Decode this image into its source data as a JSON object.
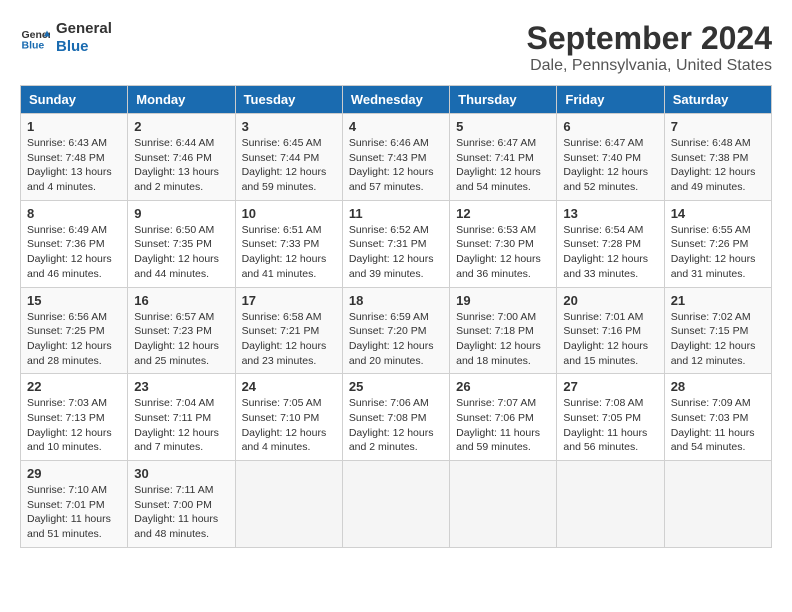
{
  "logo": {
    "line1": "General",
    "line2": "Blue"
  },
  "title": "September 2024",
  "subtitle": "Dale, Pennsylvania, United States",
  "weekdays": [
    "Sunday",
    "Monday",
    "Tuesday",
    "Wednesday",
    "Thursday",
    "Friday",
    "Saturday"
  ],
  "weeks": [
    [
      {
        "day": "1",
        "info": "Sunrise: 6:43 AM\nSunset: 7:48 PM\nDaylight: 13 hours\nand 4 minutes."
      },
      {
        "day": "2",
        "info": "Sunrise: 6:44 AM\nSunset: 7:46 PM\nDaylight: 13 hours\nand 2 minutes."
      },
      {
        "day": "3",
        "info": "Sunrise: 6:45 AM\nSunset: 7:44 PM\nDaylight: 12 hours\nand 59 minutes."
      },
      {
        "day": "4",
        "info": "Sunrise: 6:46 AM\nSunset: 7:43 PM\nDaylight: 12 hours\nand 57 minutes."
      },
      {
        "day": "5",
        "info": "Sunrise: 6:47 AM\nSunset: 7:41 PM\nDaylight: 12 hours\nand 54 minutes."
      },
      {
        "day": "6",
        "info": "Sunrise: 6:47 AM\nSunset: 7:40 PM\nDaylight: 12 hours\nand 52 minutes."
      },
      {
        "day": "7",
        "info": "Sunrise: 6:48 AM\nSunset: 7:38 PM\nDaylight: 12 hours\nand 49 minutes."
      }
    ],
    [
      {
        "day": "8",
        "info": "Sunrise: 6:49 AM\nSunset: 7:36 PM\nDaylight: 12 hours\nand 46 minutes."
      },
      {
        "day": "9",
        "info": "Sunrise: 6:50 AM\nSunset: 7:35 PM\nDaylight: 12 hours\nand 44 minutes."
      },
      {
        "day": "10",
        "info": "Sunrise: 6:51 AM\nSunset: 7:33 PM\nDaylight: 12 hours\nand 41 minutes."
      },
      {
        "day": "11",
        "info": "Sunrise: 6:52 AM\nSunset: 7:31 PM\nDaylight: 12 hours\nand 39 minutes."
      },
      {
        "day": "12",
        "info": "Sunrise: 6:53 AM\nSunset: 7:30 PM\nDaylight: 12 hours\nand 36 minutes."
      },
      {
        "day": "13",
        "info": "Sunrise: 6:54 AM\nSunset: 7:28 PM\nDaylight: 12 hours\nand 33 minutes."
      },
      {
        "day": "14",
        "info": "Sunrise: 6:55 AM\nSunset: 7:26 PM\nDaylight: 12 hours\nand 31 minutes."
      }
    ],
    [
      {
        "day": "15",
        "info": "Sunrise: 6:56 AM\nSunset: 7:25 PM\nDaylight: 12 hours\nand 28 minutes."
      },
      {
        "day": "16",
        "info": "Sunrise: 6:57 AM\nSunset: 7:23 PM\nDaylight: 12 hours\nand 25 minutes."
      },
      {
        "day": "17",
        "info": "Sunrise: 6:58 AM\nSunset: 7:21 PM\nDaylight: 12 hours\nand 23 minutes."
      },
      {
        "day": "18",
        "info": "Sunrise: 6:59 AM\nSunset: 7:20 PM\nDaylight: 12 hours\nand 20 minutes."
      },
      {
        "day": "19",
        "info": "Sunrise: 7:00 AM\nSunset: 7:18 PM\nDaylight: 12 hours\nand 18 minutes."
      },
      {
        "day": "20",
        "info": "Sunrise: 7:01 AM\nSunset: 7:16 PM\nDaylight: 12 hours\nand 15 minutes."
      },
      {
        "day": "21",
        "info": "Sunrise: 7:02 AM\nSunset: 7:15 PM\nDaylight: 12 hours\nand 12 minutes."
      }
    ],
    [
      {
        "day": "22",
        "info": "Sunrise: 7:03 AM\nSunset: 7:13 PM\nDaylight: 12 hours\nand 10 minutes."
      },
      {
        "day": "23",
        "info": "Sunrise: 7:04 AM\nSunset: 7:11 PM\nDaylight: 12 hours\nand 7 minutes."
      },
      {
        "day": "24",
        "info": "Sunrise: 7:05 AM\nSunset: 7:10 PM\nDaylight: 12 hours\nand 4 minutes."
      },
      {
        "day": "25",
        "info": "Sunrise: 7:06 AM\nSunset: 7:08 PM\nDaylight: 12 hours\nand 2 minutes."
      },
      {
        "day": "26",
        "info": "Sunrise: 7:07 AM\nSunset: 7:06 PM\nDaylight: 11 hours\nand 59 minutes."
      },
      {
        "day": "27",
        "info": "Sunrise: 7:08 AM\nSunset: 7:05 PM\nDaylight: 11 hours\nand 56 minutes."
      },
      {
        "day": "28",
        "info": "Sunrise: 7:09 AM\nSunset: 7:03 PM\nDaylight: 11 hours\nand 54 minutes."
      }
    ],
    [
      {
        "day": "29",
        "info": "Sunrise: 7:10 AM\nSunset: 7:01 PM\nDaylight: 11 hours\nand 51 minutes."
      },
      {
        "day": "30",
        "info": "Sunrise: 7:11 AM\nSunset: 7:00 PM\nDaylight: 11 hours\nand 48 minutes."
      },
      {
        "day": "",
        "info": ""
      },
      {
        "day": "",
        "info": ""
      },
      {
        "day": "",
        "info": ""
      },
      {
        "day": "",
        "info": ""
      },
      {
        "day": "",
        "info": ""
      }
    ]
  ]
}
